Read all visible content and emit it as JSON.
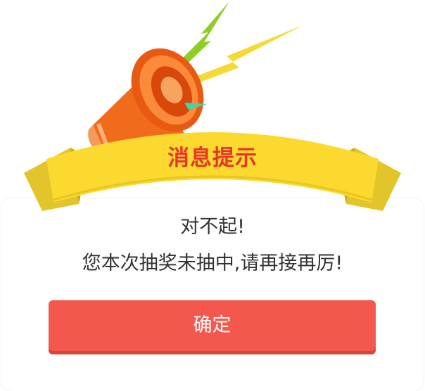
{
  "dialog": {
    "title": "消息提示",
    "message_line1": "对不起!",
    "message_line2": "您本次抽奖未抽中,请再接再厉!",
    "confirm_label": "确定"
  },
  "colors": {
    "ribbon": "#fbd92f",
    "ribbon_dark": "#e2b21c",
    "title_red": "#e8342a",
    "button": "#f4574d",
    "megaphone": "#f06b1c",
    "lightning_green": "#8fcc25",
    "lightning_yellow": "#f4da35"
  },
  "icons": [
    "megaphone-icon",
    "lightning-icon"
  ]
}
